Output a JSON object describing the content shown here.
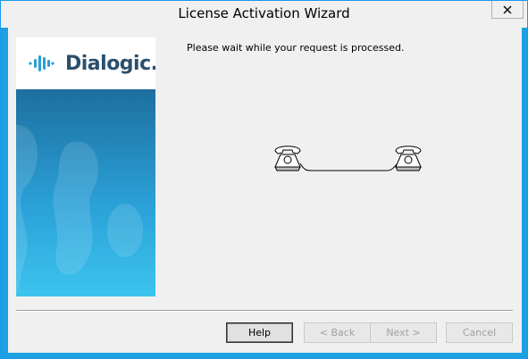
{
  "window": {
    "title": "License Activation Wizard"
  },
  "banner": {
    "logo_text": "Dialogic."
  },
  "content": {
    "status": "Please wait while your request is processed."
  },
  "buttons": {
    "help": "Help",
    "back": "< Back",
    "next": "Next >",
    "cancel": "Cancel"
  },
  "colors": {
    "accent": "#1ba1e2",
    "banner_top": "#1d6f9f",
    "banner_bottom": "#3cc4ef",
    "logo": "#2a4f6d"
  },
  "icons": [
    "close-icon",
    "dialogic-logo-icon",
    "telephone-icon"
  ]
}
